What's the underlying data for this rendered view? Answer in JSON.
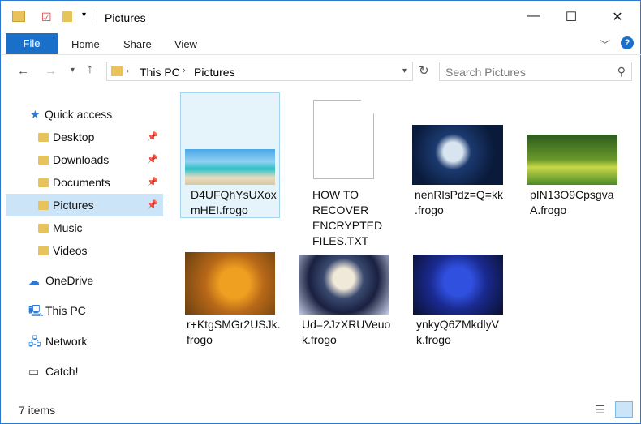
{
  "window": {
    "title": "Pictures",
    "controls": {
      "minimize": "—",
      "maximize": "☐",
      "close": "✕"
    }
  },
  "ribbon": {
    "file": "File",
    "tabs": [
      "Home",
      "Share",
      "View"
    ],
    "help": "?"
  },
  "address": {
    "path": [
      "This PC",
      "Pictures"
    ],
    "search_placeholder": "Search Pictures"
  },
  "sidebar": {
    "items": [
      {
        "label": "Quick access",
        "icon": "star-icon"
      },
      {
        "label": "Desktop",
        "icon": "folder-icon",
        "pinned": true
      },
      {
        "label": "Downloads",
        "icon": "folder-icon",
        "pinned": true
      },
      {
        "label": "Documents",
        "icon": "folder-icon",
        "pinned": true
      },
      {
        "label": "Pictures",
        "icon": "folder-icon",
        "pinned": true,
        "selected": true
      },
      {
        "label": "Music",
        "icon": "folder-icon"
      },
      {
        "label": "Videos",
        "icon": "folder-icon"
      },
      {
        "label": "OneDrive",
        "icon": "cloud-icon"
      },
      {
        "label": "This PC",
        "icon": "computer-icon"
      },
      {
        "label": "Network",
        "icon": "network-icon"
      },
      {
        "label": "Catch!",
        "icon": "drive-icon"
      }
    ]
  },
  "files": [
    {
      "name1": "D4UFQhYsUXox",
      "name2": "mHEI.frogo"
    },
    {
      "name1": "HOW TO",
      "name2": "RECOVER",
      "name3": "ENCRYPTED",
      "name4": "FILES.TXT"
    },
    {
      "name1": "nenRlsPdz=Q=kk",
      "name2": ".frogo"
    },
    {
      "name1": "pIN13O9CpsgvaA",
      "name2": "A.frogo"
    },
    {
      "name1": "r+KtgSMGr2USJk.",
      "name2": "frogo"
    },
    {
      "name1": "Ud=2JzXRUVeuo",
      "name2": "k.frogo"
    },
    {
      "name1": "ynkyQ6ZMkdlyV",
      "name2": "k.frogo"
    }
  ],
  "status": {
    "count": "7 items"
  }
}
